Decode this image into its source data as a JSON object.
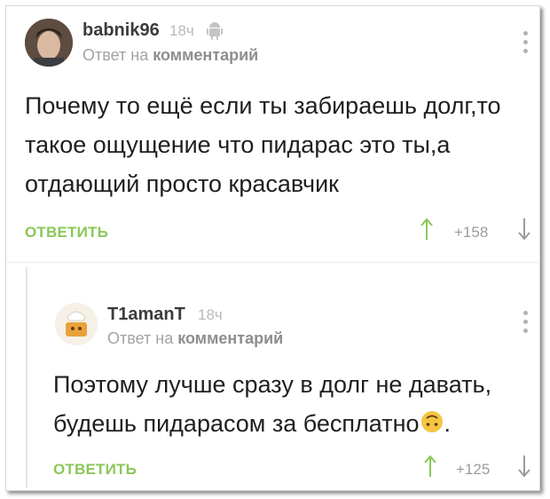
{
  "comment1": {
    "username": "babnik96",
    "time": "18ч",
    "platform_icon": "android-icon",
    "reply_prefix": "Ответ на",
    "reply_target": "комментарий",
    "text": "Почему то ещё если ты забираешь долг,то такое ощущение что пидарас это ты,а отдающий просто красавчик",
    "reply_label": "ОТВЕТИТЬ",
    "score": "+158"
  },
  "comment2": {
    "username": "T1amanT",
    "time": "18ч",
    "reply_prefix": "Ответ на",
    "reply_target": "комментарий",
    "text": "Поэтому лучше сразу в долг не давать, будешь пидарасом за бесплатно",
    "text_end": ".",
    "emoji": "upside-down-smile-emoji",
    "reply_label": "ОТВЕТИТЬ",
    "score": "+125"
  },
  "colors": {
    "accent_green": "#8ac858",
    "emoji_yellow": "#f5c441"
  }
}
